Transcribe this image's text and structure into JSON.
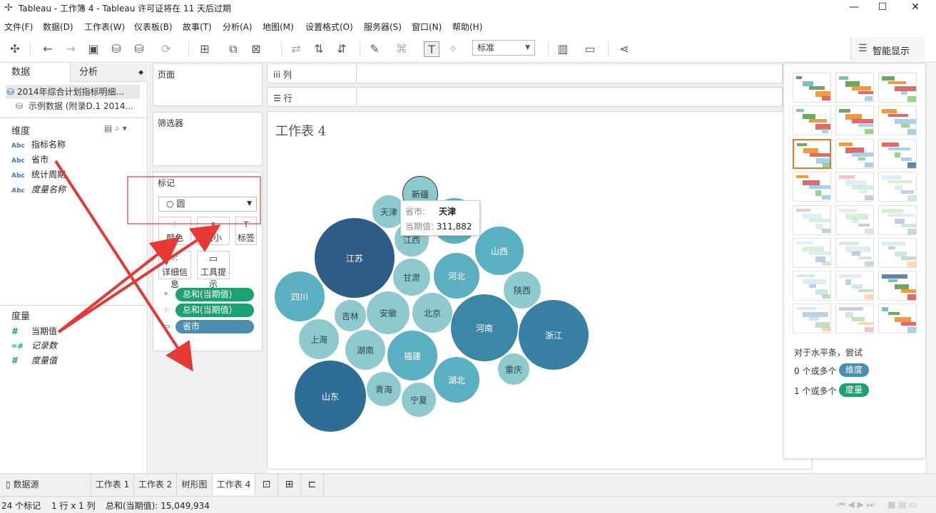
{
  "window": {
    "title": "Tableau - 工作簿 4 - Tableau 许可证将在 11 天后过期"
  },
  "menu": [
    "文件(F)",
    "数据(D)",
    "工作表(W)",
    "仪表板(B)",
    "故事(T)",
    "分析(A)",
    "地图(M)",
    "设置格式(O)",
    "服务器(S)",
    "窗口(N)",
    "帮助(H)"
  ],
  "toolbar": {
    "mark_size_select": "标准",
    "show_me": "智能显示"
  },
  "left_panel": {
    "tab_data": "数据",
    "tab_analysis": "分析",
    "datasources": [
      "2014年综合计划指标明细...",
      "示例数据 (附录D.1 2014..."
    ],
    "dimensions_header": "维度",
    "dimensions": [
      {
        "type": "Abc",
        "name": "指标名称"
      },
      {
        "type": "Abc",
        "name": "省市"
      },
      {
        "type": "Abc",
        "name": "统计周期"
      },
      {
        "type": "Abc",
        "name": "度量名称"
      }
    ],
    "measures_header": "度量",
    "measures": [
      {
        "type": "#",
        "name": "当期值"
      },
      {
        "type": "=#",
        "name": "记录数"
      },
      {
        "type": "#",
        "name": "度量值"
      }
    ]
  },
  "shelves": {
    "pages": "页面",
    "filters": "筛选器",
    "marks": "标记",
    "mark_type": "圆",
    "columns": "列",
    "rows": "行",
    "mark_buttons": [
      "颜色",
      "大小",
      "标签",
      "详细信息",
      "工具提示"
    ],
    "mark_pills": [
      {
        "label": "总和(当期值)",
        "color": "#1ea06f"
      },
      {
        "label": "总和(当期值)",
        "color": "#1ea06f"
      },
      {
        "label": "省市",
        "color": "#4a8fb0"
      }
    ]
  },
  "view": {
    "sheet_title": "工作表 4"
  },
  "chart_data": {
    "type": "packed-bubble",
    "dimension": "省市",
    "measure": "总和(当期值)",
    "points": [
      {
        "name": "新疆"
      },
      {
        "name": "天津",
        "value": 311882
      },
      {
        "name": "江苏"
      },
      {
        "name": "江西"
      },
      {
        "name": "山西"
      },
      {
        "name": "甘肃"
      },
      {
        "name": "河北"
      },
      {
        "name": "四川"
      },
      {
        "name": "陕西"
      },
      {
        "name": "吉林"
      },
      {
        "name": "安徽"
      },
      {
        "name": "北京"
      },
      {
        "name": "河南"
      },
      {
        "name": "浙江"
      },
      {
        "name": "上海"
      },
      {
        "name": "湖南"
      },
      {
        "name": "福建"
      },
      {
        "name": "重庆"
      },
      {
        "name": "山东"
      },
      {
        "name": "青海"
      },
      {
        "name": "宁夏"
      },
      {
        "name": "湖北"
      }
    ]
  },
  "tooltip": {
    "k1": "省市:",
    "v1": "天津",
    "k2": "当期值:",
    "v2": "311,882"
  },
  "show_me": {
    "hint_title": "对于水平条，尝试",
    "hint1_prefix": "0 个或多个",
    "hint1_pill": "维度",
    "hint2_prefix": "1 个或多个",
    "hint2_pill": "度量"
  },
  "sheet_tabs": [
    "数据源",
    "工作表 1",
    "工作表 2",
    "树形图",
    "工作表 4"
  ],
  "status": {
    "marks": "24 个标记",
    "dims": "1 行 x 1 列",
    "sum": "总和(当期值): 15,049,934"
  }
}
